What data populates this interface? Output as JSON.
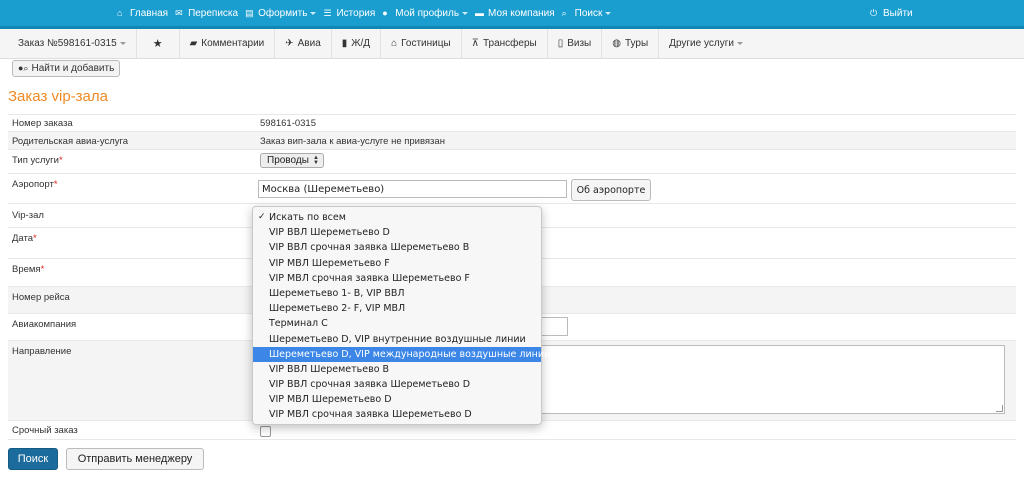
{
  "topnav": {
    "items": [
      {
        "icon": "home-icon",
        "label": "Главная",
        "caret": false
      },
      {
        "icon": "envelope-icon",
        "label": "Переписка",
        "caret": false
      },
      {
        "icon": "cart-icon",
        "label": "Оформить",
        "caret": true
      },
      {
        "icon": "list-icon",
        "label": "История",
        "caret": false
      },
      {
        "icon": "user-icon",
        "label": "Мой профиль",
        "caret": true
      },
      {
        "icon": "company-icon",
        "label": "Моя компания",
        "caret": false
      },
      {
        "icon": "search-icon",
        "label": "Поиск",
        "caret": true
      }
    ],
    "logout": "Выйти"
  },
  "subnav": {
    "order": "Заказ №598161-0315",
    "items": [
      {
        "icon": "comment-icon",
        "label": "Комментарии"
      },
      {
        "icon": "plane-icon",
        "label": "Авиа"
      },
      {
        "icon": "bookmark-icon",
        "label": "Ж/Д"
      },
      {
        "icon": "home-icon",
        "label": "Гостиницы"
      },
      {
        "icon": "road-icon",
        "label": "Трансферы"
      },
      {
        "icon": "passport-icon",
        "label": "Визы"
      },
      {
        "icon": "globe-icon",
        "label": "Туры"
      }
    ],
    "other": "Другие услуги"
  },
  "find_button": "Найти и добавить",
  "page_title": "Заказ vip-зала",
  "form": {
    "order_number_label": "Номер заказа",
    "order_number_value": "598161-0315",
    "parent_label": "Родительская авиа-услуга",
    "parent_value": "Заказ вип-зала к авиа-услуге не привязан",
    "service_type_label": "Тип услуги",
    "service_type_value": "Проводы",
    "airport_label": "Аэропорт",
    "airport_value": "Москва (Шереметьево)",
    "airport_button": "Об аэропорте",
    "vip_label": "Vip-зал",
    "date_label": "Дата",
    "time_label": "Время",
    "flight_label": "Номер рейса",
    "airline_label": "Авиакомпания",
    "direction_label": "Направление",
    "urgent_label": "Срочный заказ",
    "required_mark": "*"
  },
  "dropdown": {
    "check_mark": "✓",
    "highlighted_index": 9,
    "options": [
      "Искать по всем",
      "VIP ВВЛ Шереметьево D",
      "VIP ВВЛ срочная заявка Шереметьево B",
      "VIP МВЛ Шереметьево F",
      "VIP МВЛ срочная заявка Шереметьево F",
      "Шереметьево 1- B, VIP ВВЛ",
      "Шереметьево 2- F, VIP МВЛ",
      "Терминал С",
      "Шереметьево D, VIP внутренние воздушные линии",
      "Шереметьево D, VIP международные воздушные линии",
      "VIP ВВЛ Шереметьево B",
      "VIP ВВЛ срочная заявка Шереметьево D",
      "VIP МВЛ Шереметьево D",
      "VIP МВЛ срочная заявка Шереметьево D"
    ]
  },
  "buttons": {
    "search": "Поиск",
    "send": "Отправить менеджеру"
  },
  "colors": {
    "topbar": "#1a9dcf",
    "title": "#f08a24",
    "highlight": "#3b86e6",
    "primary_button": "#1b6b9c"
  }
}
